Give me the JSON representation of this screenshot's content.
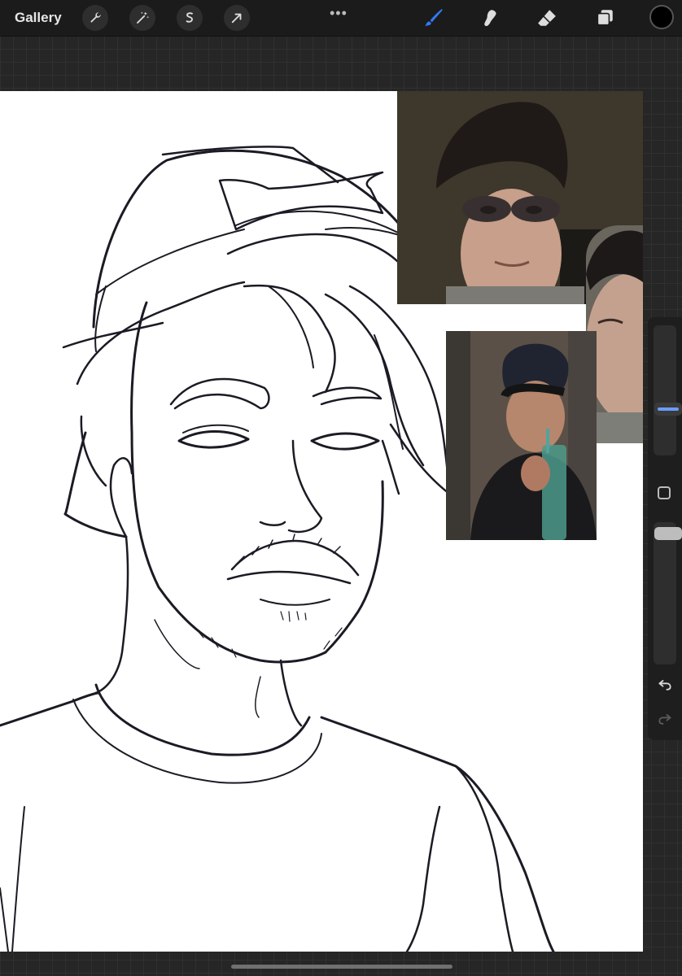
{
  "app": {
    "gallery_label": "Gallery",
    "more_label": "•••"
  },
  "toolbar": {
    "left_tools": [
      "wrench-icon",
      "magic-wand-icon",
      "selection-icon",
      "transform-arrow-icon"
    ],
    "right_tools": [
      "brush-icon",
      "smudge-icon",
      "eraser-icon",
      "layers-icon"
    ],
    "active_tool": "brush-icon",
    "active_color": "#2f7bf5",
    "current_color": "#000000"
  },
  "sidebar": {
    "brush_size_level": 0.27,
    "opacity_level": 0.04,
    "accent_color": "#6b9cff"
  },
  "reference_photos": [
    "reference-photo-eye-makeup",
    "reference-photo-side-face",
    "reference-photo-drinking"
  ]
}
